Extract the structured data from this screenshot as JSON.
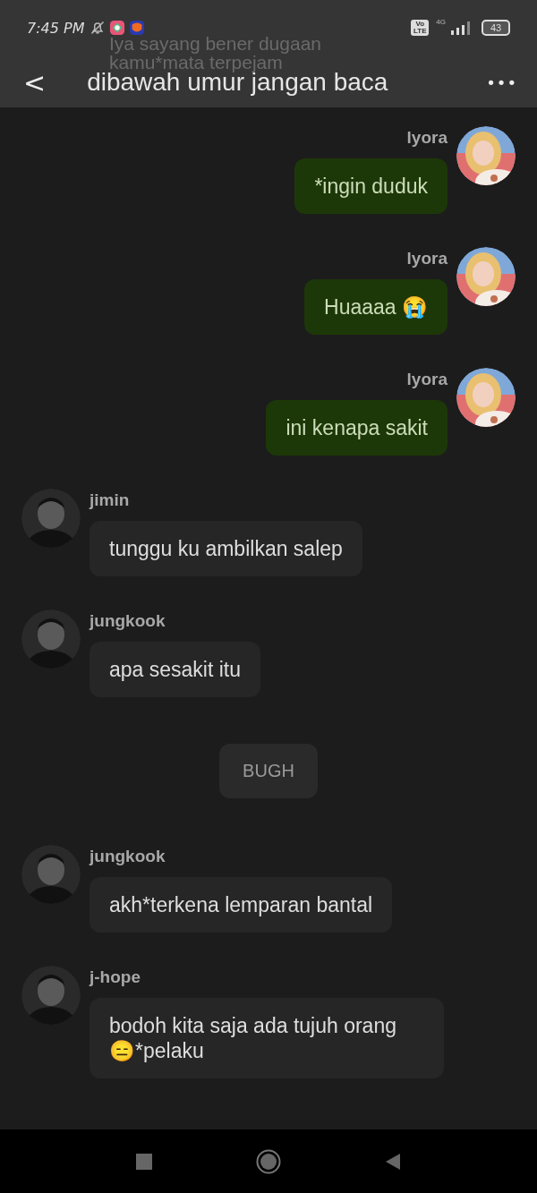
{
  "status_bar": {
    "time": "7:45 PM",
    "volte": "Vo LTE",
    "network": "4G",
    "battery": "43"
  },
  "notification_ghost": "Iya sayang bener dugaan kamu*mata terpejam",
  "header": {
    "back": "<",
    "title": "dibawah umur jangan baca",
    "menu": "•••"
  },
  "messages": [
    {
      "kind": "mine",
      "name": "lyora",
      "text": "*ingin duduk"
    },
    {
      "kind": "mine",
      "name": "lyora",
      "text": "Huaaaa 😭"
    },
    {
      "kind": "mine",
      "name": "lyora",
      "text": "ini kenapa sakit"
    },
    {
      "kind": "other",
      "name": "jimin",
      "text": "tunggu ku ambilkan salep"
    },
    {
      "kind": "other",
      "name": "jungkook",
      "text": "apa sesakit itu"
    },
    {
      "kind": "system",
      "text": "BUGH"
    },
    {
      "kind": "other",
      "name": "jungkook",
      "text": "akh*terkena lemparan bantal"
    },
    {
      "kind": "other",
      "name": "j-hope",
      "text": "bodoh kita saja ada tujuh orang 😑*pelaku"
    }
  ]
}
